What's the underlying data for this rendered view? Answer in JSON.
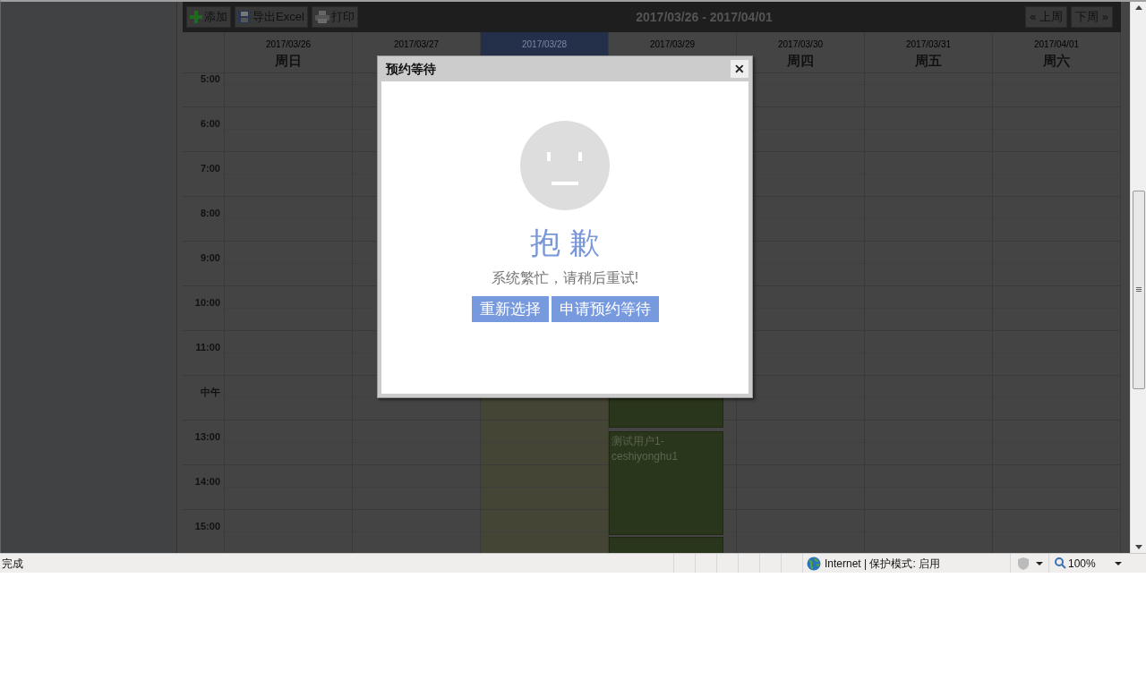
{
  "toolbar": {
    "buttons": [
      {
        "kind": "add",
        "label": "添加"
      },
      {
        "kind": "excel",
        "label": "导出Excel"
      },
      {
        "kind": "print",
        "label": "打印"
      }
    ],
    "range": "2017/03/26 - 2017/04/01",
    "nav": [
      "« 上周",
      "下周 »"
    ]
  },
  "days": [
    {
      "date": "2017/03/26",
      "day_name": "周日",
      "selected": false
    },
    {
      "date": "2017/03/27",
      "selected": false
    },
    {
      "date": "2017/03/28",
      "selected": true
    },
    {
      "date": "2017/03/29",
      "selected": false,
      "events": [
        {
          "kind": "booking"
        },
        {
          "kind": "booking",
          "text": "测试用户1-ceshiyonghu1"
        },
        {
          "kind": "booking"
        }
      ]
    },
    {
      "date": "2017/03/30",
      "day_name": "周四",
      "selected": false
    },
    {
      "date": "2017/03/31",
      "day_name": "周五",
      "selected": false
    },
    {
      "date": "2017/04/01",
      "day_name": "周六",
      "selected": false
    }
  ],
  "times": [
    "5:00",
    "6:00",
    "7:00",
    "8:00",
    "9:00",
    "10:00",
    "11:00",
    "中午",
    "13:00",
    "14:00",
    "15:00"
  ],
  "dialog": {
    "title": "预约等待",
    "close": "✕",
    "heading": "抱 歉",
    "message": "系统繁忙，请稍后重试!",
    "buttons": [
      "重新选择",
      "申请预约等待"
    ]
  },
  "status_bar": {
    "text": "完成",
    "zone": "Internet | 保护模式: 启用",
    "zoom": "100%"
  }
}
